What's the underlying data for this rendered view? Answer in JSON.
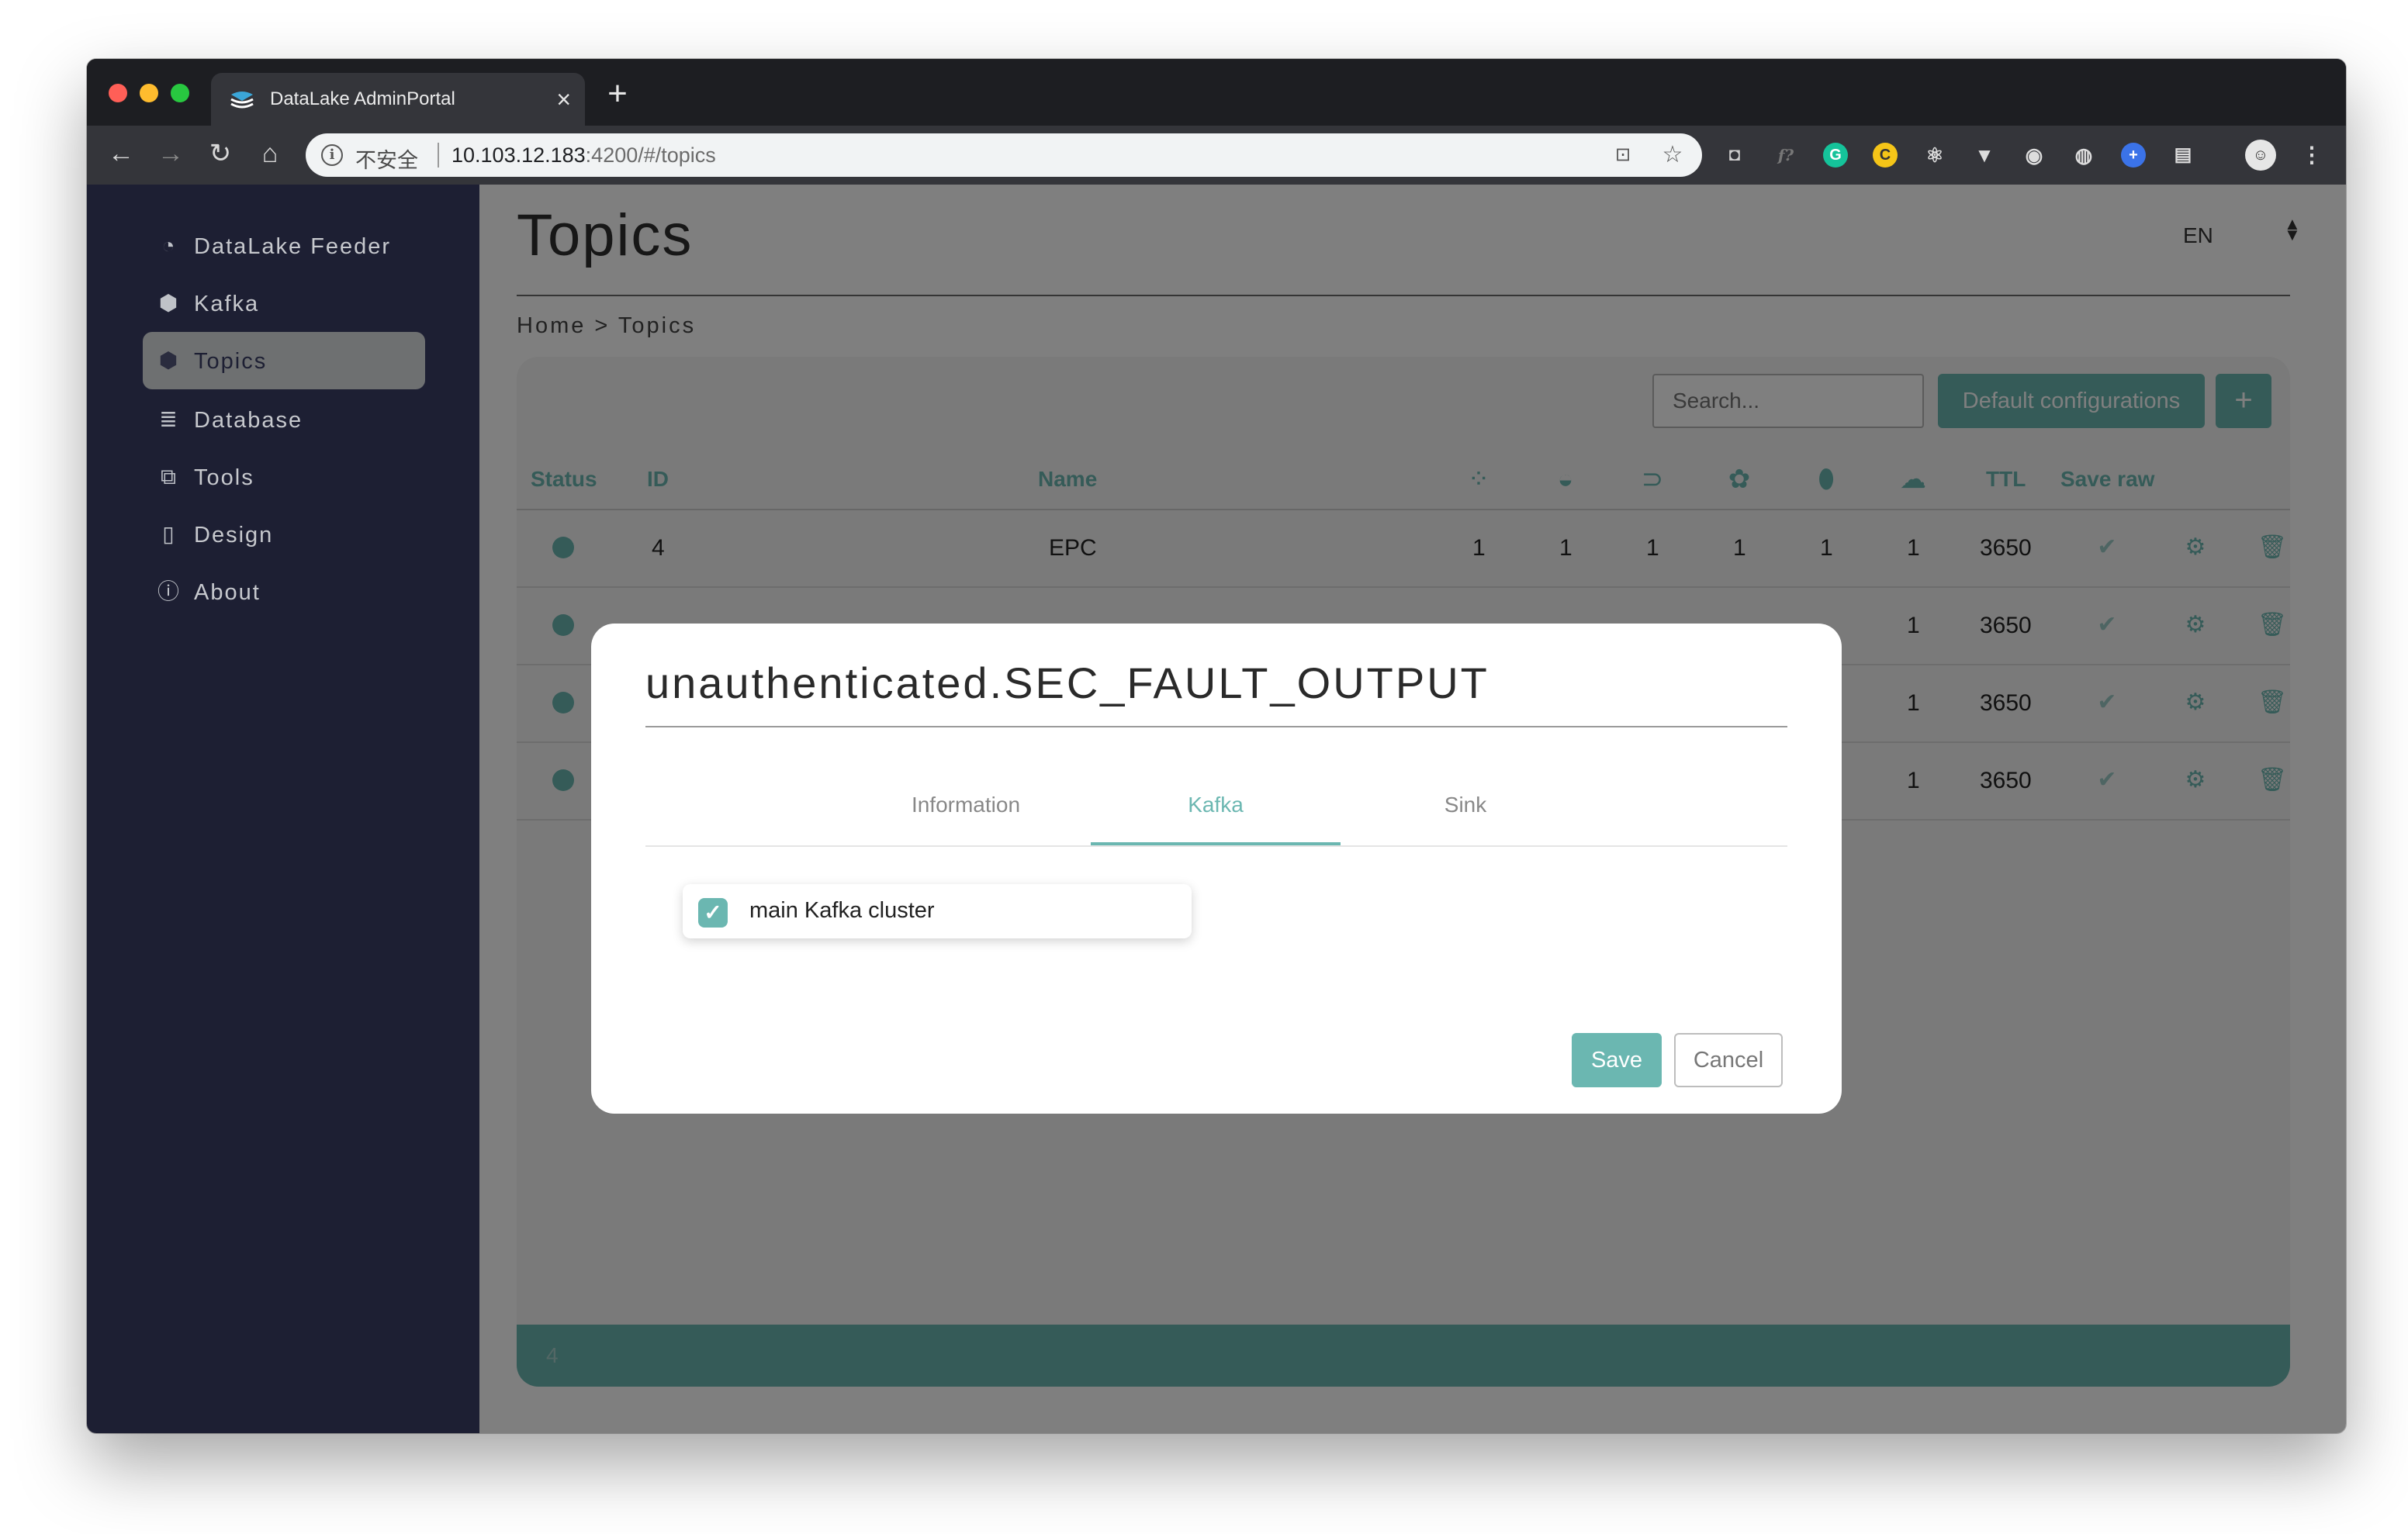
{
  "browser": {
    "tab_title": "DataLake AdminPortal",
    "tab_close": "×",
    "new_tab": "+",
    "security_label": "不安全",
    "url_host": "10.103.12.183",
    "url_path": ":4200/#/topics"
  },
  "sidebar": {
    "items": [
      {
        "label": "DataLake Feeder",
        "icon": "dashboard-icon"
      },
      {
        "label": "Kafka",
        "icon": "cube-icon"
      },
      {
        "label": "Topics",
        "icon": "cube-icon",
        "active": true
      },
      {
        "label": "Database",
        "icon": "database-icon"
      },
      {
        "label": "Tools",
        "icon": "external-link-icon"
      },
      {
        "label": "Design",
        "icon": "file-icon"
      },
      {
        "label": "About",
        "icon": "info-icon"
      }
    ]
  },
  "header": {
    "title": "Topics",
    "language": "EN",
    "breadcrumb": "Home > Topics"
  },
  "toolbar": {
    "search_placeholder": "Search...",
    "default_config_label": "Default configurations",
    "add_label": "+"
  },
  "table": {
    "columns": {
      "status": "Status",
      "id": "ID",
      "name": "Name",
      "ttl": "TTL",
      "save_raw": "Save raw"
    },
    "db_icons": [
      "couchbase-icon",
      "elasticsearch-icon",
      "druid-icon",
      "hadoop-icon",
      "mongodb-icon",
      "hive-icon"
    ],
    "rows": [
      {
        "id": "4",
        "name": "EPC",
        "db": [
          "1",
          "1",
          "1",
          "1",
          "1",
          "1"
        ],
        "ttl": "3650"
      },
      {
        "id": "",
        "name": "",
        "db": [
          "",
          "",
          "",
          "",
          "",
          "1"
        ],
        "ttl": "3650"
      },
      {
        "id": "",
        "name": "",
        "db": [
          "",
          "",
          "",
          "",
          "",
          "1"
        ],
        "ttl": "3650"
      },
      {
        "id": "",
        "name": "",
        "db": [
          "",
          "",
          "",
          "",
          "",
          "1"
        ],
        "ttl": "3650"
      }
    ],
    "footer_count": "4"
  },
  "modal": {
    "title": "unauthenticated.SEC_FAULT_OUTPUT",
    "tabs": [
      "Information",
      "Kafka",
      "Sink"
    ],
    "active_tab": "Kafka",
    "kafka_option": "main Kafka cluster",
    "kafka_option_checked": true,
    "save_label": "Save",
    "cancel_label": "Cancel"
  },
  "colors": {
    "accent": "#6bb7b1",
    "sidebar_bg": "#1d1f33"
  }
}
